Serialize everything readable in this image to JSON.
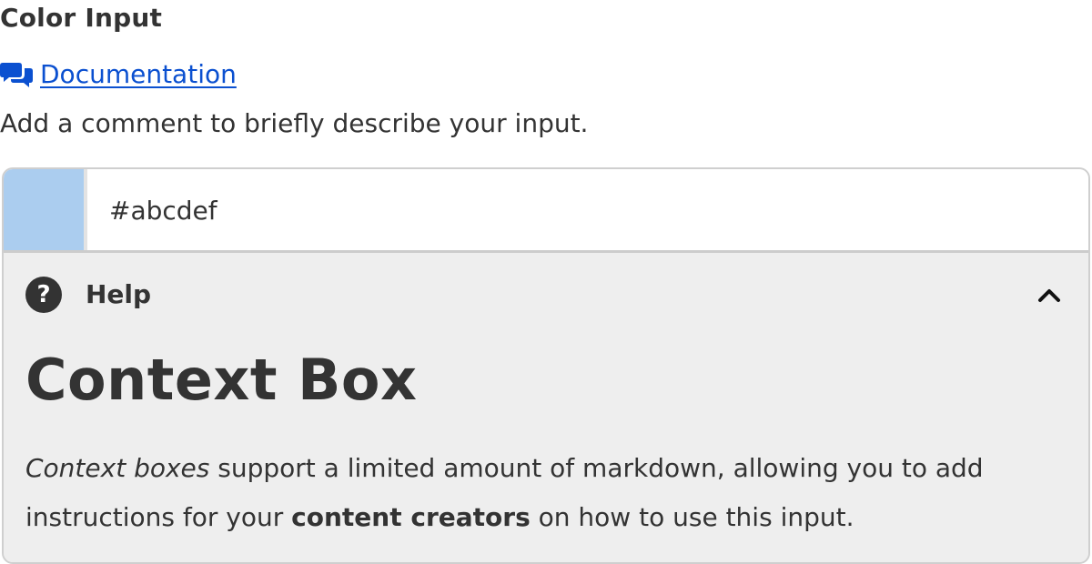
{
  "field": {
    "label": "Color Input",
    "documentation_link": "Documentation",
    "comment": "Add a comment to briefly describe your input."
  },
  "color_input": {
    "swatch_color": "#abcdef",
    "value": "#abcdef"
  },
  "help": {
    "title": "Help",
    "icon": "question-circle-icon",
    "toggle_icon": "chevron-up-icon",
    "expanded": true,
    "context_title": "Context Box",
    "body": {
      "italic_phrase": "Context boxes",
      "text_1": " support a limited amount of markdown, allowing you to add instructions for your ",
      "bold_phrase": "content creators",
      "text_2": " on how to use this input."
    }
  },
  "colors": {
    "text": "#333333",
    "link": "#0b50d0",
    "help_background": "#eeeeee",
    "border": "#cfcfcf"
  }
}
